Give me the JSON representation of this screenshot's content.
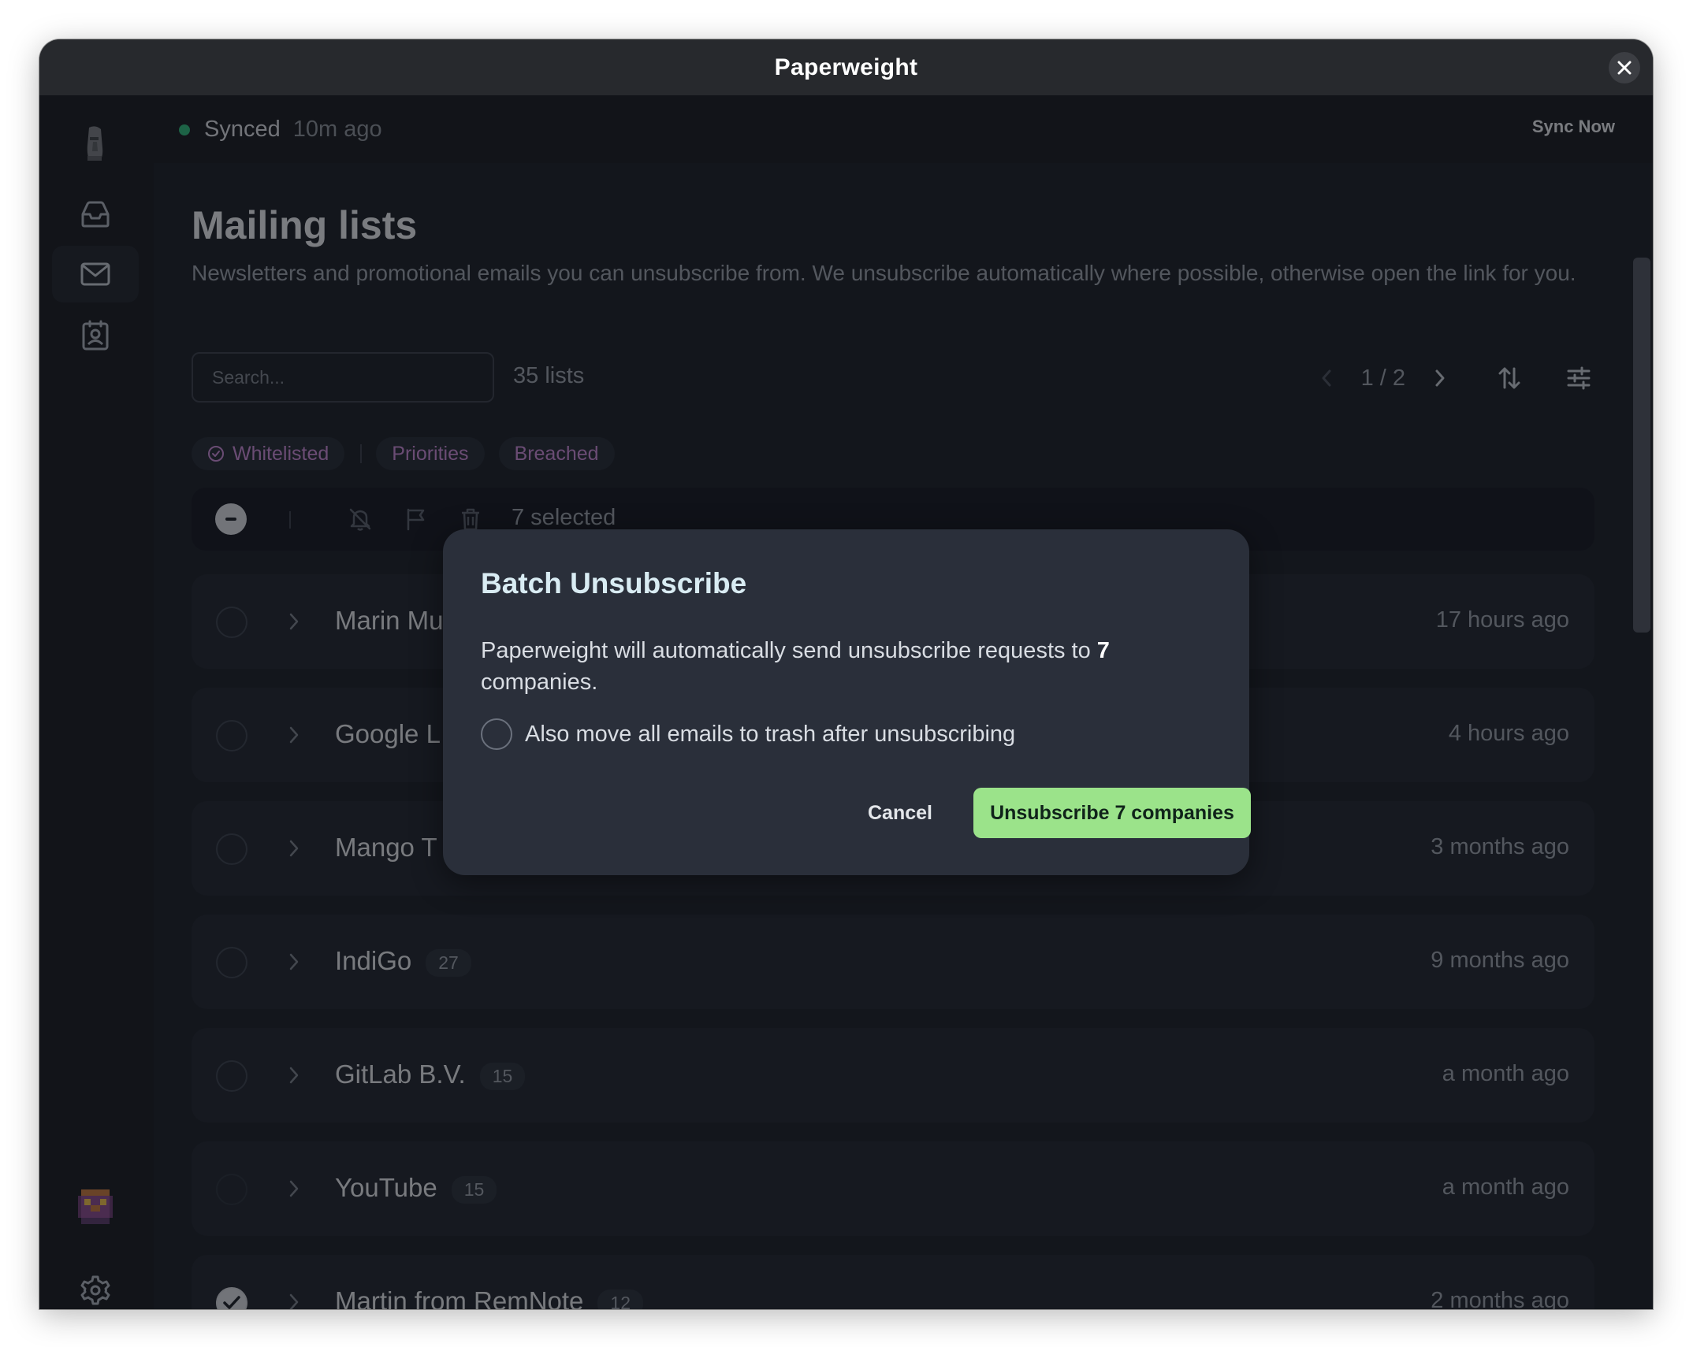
{
  "window": {
    "title": "Paperweight"
  },
  "status": {
    "state": "Synced",
    "time": "10m ago",
    "sync_label": "Sync Now"
  },
  "page": {
    "title": "Mailing lists",
    "description": "Newsletters and promotional emails you can unsubscribe from. We unsubscribe automatically where possible, otherwise open the link for you."
  },
  "search": {
    "placeholder": "Search...",
    "value": ""
  },
  "list_count": "35 lists",
  "pager": {
    "label": "1 / 2"
  },
  "filters": [
    "Whitelisted",
    "Priorities",
    "Breached"
  ],
  "toolbar": {
    "selected_label": "7 selected"
  },
  "rows": [
    {
      "name": "Marin Mu",
      "count": "",
      "time": "17 hours ago",
      "checked": false
    },
    {
      "name": "Google L",
      "count": "",
      "time": "4 hours ago",
      "checked": false
    },
    {
      "name": "Mango T",
      "count": "",
      "time": "3 months ago",
      "checked": false
    },
    {
      "name": "IndiGo",
      "count": "27",
      "time": "9 months ago",
      "checked": false
    },
    {
      "name": "GitLab B.V.",
      "count": "15",
      "time": "a month ago",
      "checked": false
    },
    {
      "name": "YouTube",
      "count": "15",
      "time": "a month ago",
      "checked": false
    },
    {
      "name": "Martin from RemNote",
      "count": "12",
      "time": "2 months ago",
      "checked": true
    }
  ],
  "dialog": {
    "title": "Batch Unsubscribe",
    "body_prefix": "Paperweight will automatically send unsubscribe requests to ",
    "body_count": "7",
    "body_suffix": " companies.",
    "checkbox_label": "Also move all emails to trash after unsubscribing",
    "cancel_label": "Cancel",
    "confirm_label": "Unsubscribe 7 companies"
  },
  "icons": {
    "sidebar": [
      "moai-avatar-icon",
      "inbox-icon",
      "mail-icon",
      "contacts-icon",
      "game-avatar-icon",
      "settings-icon"
    ],
    "toolbar": [
      "minus-icon",
      "bell-off-icon",
      "flag-icon",
      "trash-icon"
    ],
    "pager": [
      "chevron-left-icon",
      "chevron-right-icon",
      "sort-icon",
      "filter-sliders-icon"
    ]
  },
  "colors": {
    "accent_green": "#9be38a",
    "status_green": "#2fb87a",
    "chip_purple": "#c98ad6"
  }
}
